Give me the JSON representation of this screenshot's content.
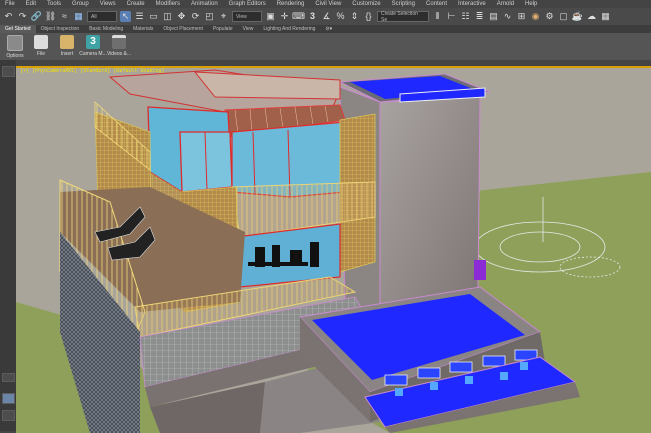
{
  "menu": [
    "File",
    "Edit",
    "Tools",
    "Group",
    "Views",
    "Create",
    "Modifiers",
    "Animation",
    "Graph Editors",
    "Rendering",
    "Civil View",
    "Customize",
    "Scripting",
    "Content",
    "Interactive",
    "Arnold",
    "Help"
  ],
  "toolbar": {
    "filter_value": "All",
    "view_value": "View",
    "selection_set_placeholder": "Create Selection Se"
  },
  "ribbon_tabs": [
    "Get Started",
    "Object Inspection",
    "Basic Modeling",
    "Materials",
    "Object Placement",
    "Populate",
    "View",
    "Lighting And Rendering"
  ],
  "ribbon_buttons": [
    {
      "label": "Options",
      "color": "#8a8a8a"
    },
    {
      "label": "File",
      "color": "#dcdcdc"
    },
    {
      "label": "Insert",
      "color": "#d7b46a"
    },
    {
      "label": "Camera M...",
      "color": "#3fa3a5"
    },
    {
      "label": "Videos &...",
      "color": "#6f6f6f"
    }
  ],
  "viewport": {
    "label": "[+] [PhysCamera001] [Standard] [Default Shading]"
  }
}
